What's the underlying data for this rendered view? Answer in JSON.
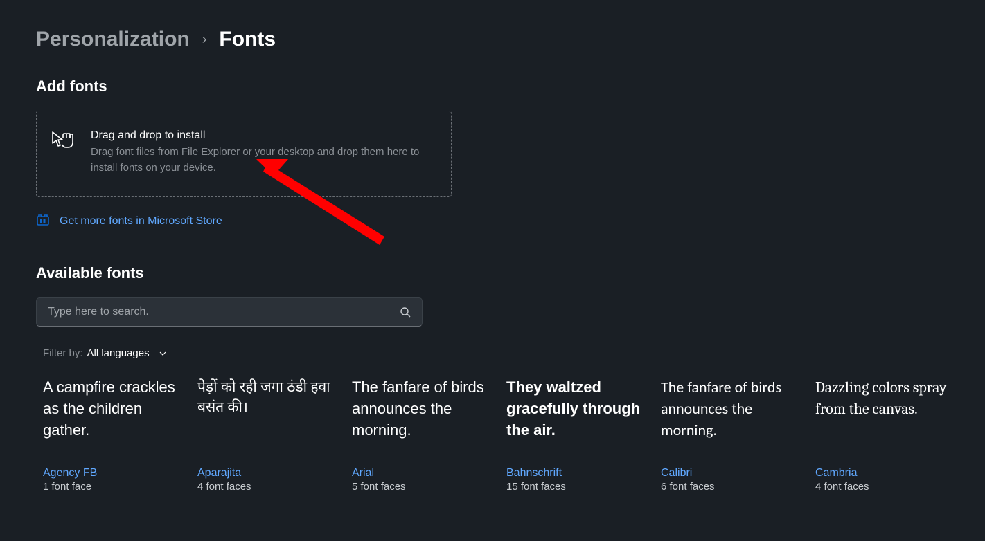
{
  "breadcrumb": {
    "parent": "Personalization",
    "separator": "›",
    "current": "Fonts"
  },
  "addFonts": {
    "title": "Add fonts",
    "dropzone": {
      "title": "Drag and drop to install",
      "description": "Drag font files from File Explorer or your desktop and drop them here to install fonts on your device."
    },
    "storeLink": "Get more fonts in Microsoft Store"
  },
  "availableFonts": {
    "title": "Available fonts",
    "search": {
      "placeholder": "Type here to search."
    },
    "filter": {
      "label": "Filter by:",
      "value": "All languages"
    },
    "items": [
      {
        "preview": "A campfire crackles as the children gather.",
        "name": "Agency FB",
        "faces": "1 font face",
        "cls": "agency"
      },
      {
        "preview": "पेड़ों को रही जगा ठंडी हवा बसंत की।",
        "name": "Aparajita",
        "faces": "4 font faces",
        "cls": "aparajita"
      },
      {
        "preview": "The fanfare of birds announces the morning.",
        "name": "Arial",
        "faces": "5 font faces",
        "cls": "arial"
      },
      {
        "preview": "They waltzed gracefully through the air.",
        "name": "Bahnschrift",
        "faces": "15 font faces",
        "cls": "bahnschrift"
      },
      {
        "preview": "The fanfare of birds announces the morning.",
        "name": "Calibri",
        "faces": "6 font faces",
        "cls": "calibri"
      },
      {
        "preview": "Dazzling colors spray from the canvas.",
        "name": "Cambria",
        "faces": "4 font faces",
        "cls": "cambria"
      }
    ]
  }
}
